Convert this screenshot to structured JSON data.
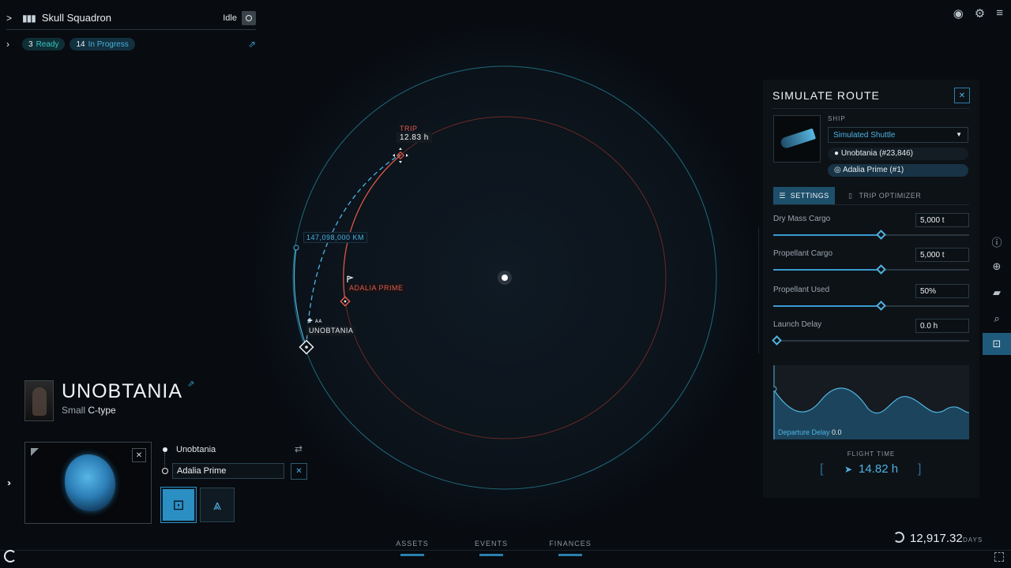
{
  "squadron": {
    "name": "Skull Squadron",
    "status": "Idle",
    "chevron": ">",
    "icon": "crew-icon"
  },
  "tasks": {
    "ready_count": "3",
    "ready_label": "Ready",
    "progress_count": "14",
    "progress_label": "In Progress"
  },
  "top_icons": [
    "eye-icon",
    "gear-icon",
    "menu-icon"
  ],
  "map": {
    "trip_label": "TRIP",
    "trip_value": "12.83 h",
    "distance": "147,098,000 KM",
    "destination": "ADALIA PRIME",
    "origin": "UNOBTANIA"
  },
  "asteroid": {
    "name": "UNOBTANIA",
    "size": "Small",
    "type": "C-type"
  },
  "route": {
    "origin": "Unobtania",
    "destination": "Adalia Prime",
    "close": "✕"
  },
  "panel": {
    "title": "SIMULATE ROUTE",
    "close": "✕",
    "ship_label": "SHIP",
    "ship_selected": "Simulated Shuttle",
    "origin": "Unobtania (#23,846)",
    "destination": "Adalia Prime (#1)",
    "tab_settings": "SETTINGS",
    "tab_optimizer": "TRIP OPTIMIZER",
    "sliders": [
      {
        "label": "Dry Mass Cargo",
        "value": "5,000 t",
        "fraction": 0.55
      },
      {
        "label": "Propellant Cargo",
        "value": "5,000 t",
        "fraction": 0.55
      },
      {
        "label": "Propellant Used",
        "value": "50%",
        "fraction": 0.55
      },
      {
        "label": "Launch Delay",
        "value": "0.0 h",
        "fraction": 0.0
      }
    ],
    "graph_label": "Departure Delay",
    "graph_value": "0.0",
    "flight_time_label": "FLIGHT TIME",
    "flight_time_value": "14.82 h"
  },
  "right_tools": [
    "info-icon",
    "crosshair-icon",
    "bookmark-icon",
    "search-icon",
    "route-icon"
  ],
  "nav": {
    "assets": "ASSETS",
    "events": "EVENTS",
    "finances": "FINANCES"
  },
  "time": {
    "value": "12,917.32",
    "unit": "DAYS"
  },
  "colors": {
    "accent": "#4fb2e0",
    "route_red": "#e05a4c",
    "orbit_teal": "#1f6a7a"
  }
}
